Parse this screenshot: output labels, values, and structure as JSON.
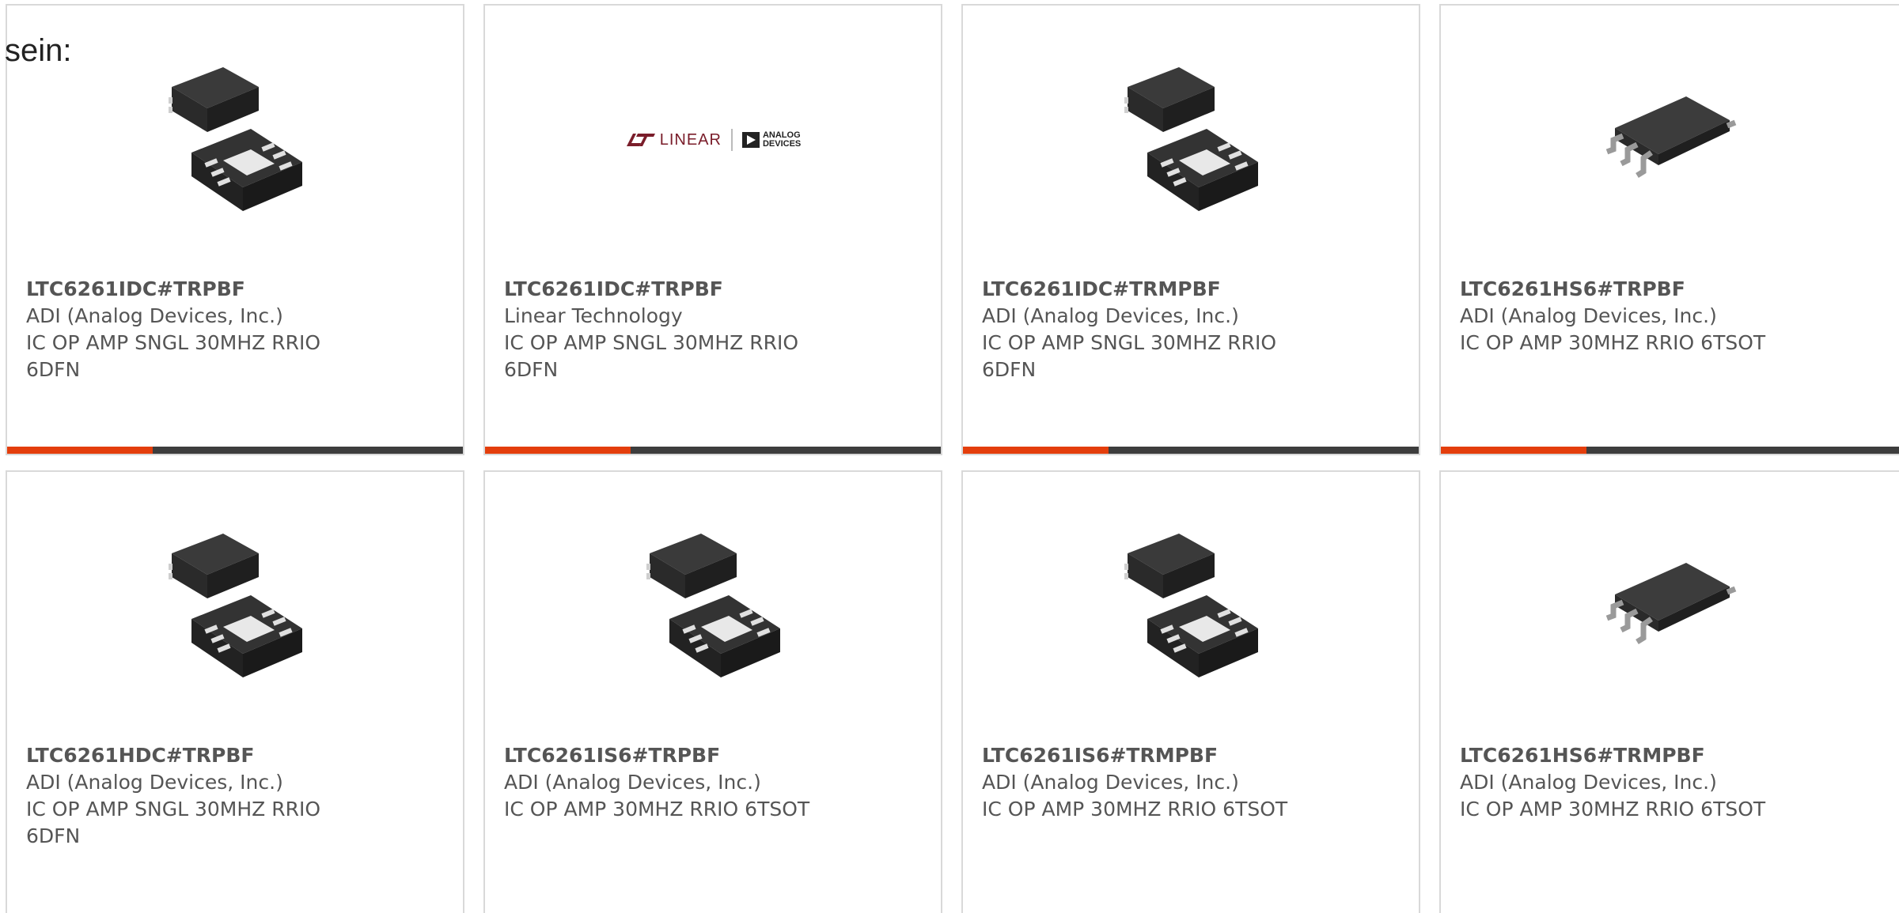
{
  "intro_text": "sein:",
  "colors": {
    "card_border": "#d9d9d9",
    "bar_dark": "#3d3d3d",
    "bar_accent": "#e43e0c",
    "text": "#555555"
  },
  "products": [
    {
      "part_number": "LTC6261IDC#TRPBF",
      "manufacturer": "ADI (Analog Devices, Inc.)",
      "description_line1": "IC OP AMP SNGL 30MHZ RRIO",
      "description_line2": "6DFN",
      "image": "dfn-package-icon",
      "accent_bar": true
    },
    {
      "part_number": "LTC6261IDC#TRPBF",
      "manufacturer": "Linear Technology",
      "description_line1": "IC OP AMP SNGL 30MHZ RRIO",
      "description_line2": "6DFN",
      "image": "linear-adi-logo",
      "logo_text_left": "LINEAR",
      "logo_text_right_line1": "ANALOG",
      "logo_text_right_line2": "DEVICES",
      "accent_bar": true
    },
    {
      "part_number": "LTC6261IDC#TRMPBF",
      "manufacturer": "ADI (Analog Devices, Inc.)",
      "description_line1": "IC OP AMP SNGL 30MHZ RRIO",
      "description_line2": "6DFN",
      "image": "dfn-package-icon",
      "accent_bar": true
    },
    {
      "part_number": "LTC6261HS6#TRPBF",
      "manufacturer": "ADI (Analog Devices, Inc.)",
      "description_line1": "IC OP AMP 30MHZ RRIO 6TSOT",
      "description_line2": "",
      "image": "tsot-package-icon",
      "accent_bar": true
    },
    {
      "part_number": "LTC6261HDC#TRPBF",
      "manufacturer": "ADI (Analog Devices, Inc.)",
      "description_line1": "IC OP AMP SNGL 30MHZ RRIO",
      "description_line2": "6DFN",
      "image": "dfn-package-icon",
      "accent_bar": false
    },
    {
      "part_number": "LTC6261IS6#TRPBF",
      "manufacturer": "ADI (Analog Devices, Inc.)",
      "description_line1": "IC OP AMP 30MHZ RRIO 6TSOT",
      "description_line2": "",
      "image": "dfn-package-icon",
      "accent_bar": false
    },
    {
      "part_number": "LTC6261IS6#TRMPBF",
      "manufacturer": "ADI (Analog Devices, Inc.)",
      "description_line1": "IC OP AMP 30MHZ RRIO 6TSOT",
      "description_line2": "",
      "image": "dfn-package-icon",
      "accent_bar": false
    },
    {
      "part_number": "LTC6261HS6#TRMPBF",
      "manufacturer": "ADI (Analog Devices, Inc.)",
      "description_line1": "IC OP AMP 30MHZ RRIO 6TSOT",
      "description_line2": "",
      "image": "tsot-package-icon",
      "accent_bar": false
    }
  ]
}
